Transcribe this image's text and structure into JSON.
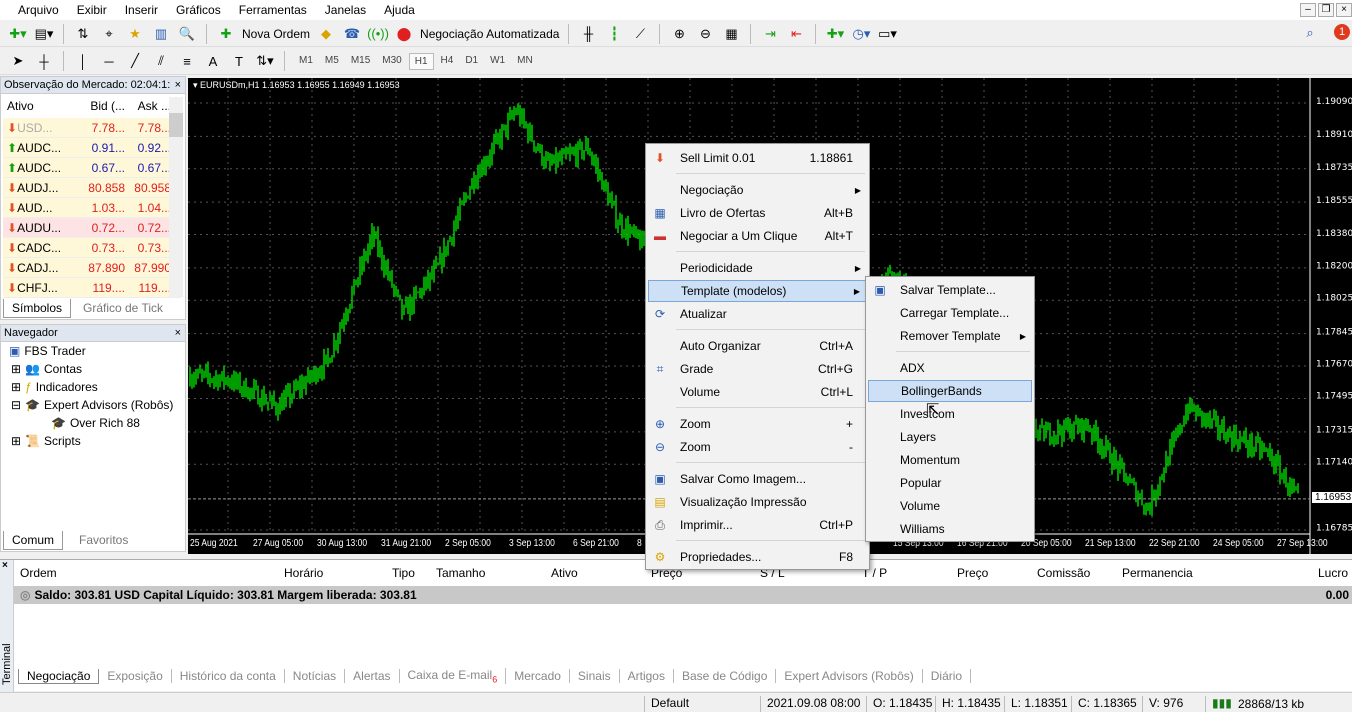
{
  "menu": [
    "Arquivo",
    "Exibir",
    "Inserir",
    "Gráficos",
    "Ferramentas",
    "Janelas",
    "Ajuda"
  ],
  "toolbar": {
    "new_order": "Nova Ordem",
    "auto_trading": "Negociação Automatizada",
    "notif_count": "1"
  },
  "timeframes": [
    "M1",
    "M5",
    "M15",
    "M30",
    "H1",
    "H4",
    "D1",
    "W1",
    "MN"
  ],
  "active_timeframe": "H1",
  "market_watch": {
    "title": "Observação do Mercado: 02:04:1:",
    "cols": [
      "Ativo",
      "Bid (...",
      "Ask ..."
    ],
    "rows": [
      {
        "sym": "USD...",
        "bid": "7.78...",
        "ask": "7.78...",
        "dir": "down",
        "color": "red",
        "dim": true
      },
      {
        "sym": "AUDC...",
        "bid": "0.91...",
        "ask": "0.92...",
        "dir": "up",
        "color": "blue"
      },
      {
        "sym": "AUDC...",
        "bid": "0.67...",
        "ask": "0.67...",
        "dir": "up",
        "color": "blue"
      },
      {
        "sym": "AUDJ...",
        "bid": "80.858",
        "ask": "80.958",
        "dir": "down",
        "color": "red"
      },
      {
        "sym": "AUD...",
        "bid": "1.03...",
        "ask": "1.04...",
        "dir": "down",
        "color": "red"
      },
      {
        "sym": "AUDU...",
        "bid": "0.72...",
        "ask": "0.72...",
        "dir": "down",
        "color": "red",
        "selected": true
      },
      {
        "sym": "CADC...",
        "bid": "0.73...",
        "ask": "0.73...",
        "dir": "down",
        "color": "red"
      },
      {
        "sym": "CADJ...",
        "bid": "87.890",
        "ask": "87.990",
        "dir": "down",
        "color": "red"
      },
      {
        "sym": "CHFJ...",
        "bid": "119....",
        "ask": "119....",
        "dir": "down",
        "color": "red"
      }
    ],
    "tabs": [
      "Símbolos",
      "Gráfico de Tick"
    ]
  },
  "navigator": {
    "title": "Navegador",
    "items": [
      "FBS Trader",
      "Contas",
      "Indicadores",
      "Expert Advisors (Robôs)",
      "Over Rich 88",
      "Scripts"
    ],
    "tabs": [
      "Comum",
      "Favoritos"
    ]
  },
  "chart": {
    "header": "EURUSDm,H1  1.16953 1.16955 1.16949 1.16953",
    "current_price": "1.16953",
    "price_labels": [
      "1.19090",
      "1.18910",
      "1.18735",
      "1.18555",
      "1.18380",
      "1.18200",
      "1.18025",
      "1.17845",
      "1.17670",
      "1.17495",
      "1.17315",
      "1.17140",
      "1.16785"
    ],
    "time_labels": [
      "25 Aug 2021",
      "27 Aug 05:00",
      "30 Aug 13:00",
      "31 Aug 21:00",
      "2 Sep 05:00",
      "3 Sep 13:00",
      "6 Sep 21:00",
      "8",
      "15 Sep 13:00",
      "16 Sep 21:00",
      "20 Sep 05:00",
      "21 Sep 13:00",
      "22 Sep 21:00",
      "24 Sep 05:00",
      "27 Sep 13:00"
    ],
    "bar_color": "#00e000"
  },
  "context_menu": [
    {
      "label": "Sell Limit 0.01",
      "shortcut": "1.18861",
      "icon": "sell-arrow-icon"
    },
    {
      "label": "Negociação",
      "submenu": true
    },
    {
      "label": "Livro de Ofertas",
      "shortcut": "Alt+B",
      "icon": "depth-of-market-icon"
    },
    {
      "label": "Negociar a Um Clique",
      "shortcut": "Alt+T",
      "icon": "one-click-icon"
    },
    {
      "label": "Periodicidade",
      "submenu": true
    },
    {
      "label": "Template (modelos)",
      "submenu": true,
      "highlighted": true
    },
    {
      "label": "Atualizar",
      "icon": "refresh-icon"
    },
    {
      "label": "Auto Organizar",
      "shortcut": "Ctrl+A"
    },
    {
      "label": "Grade",
      "shortcut": "Ctrl+G",
      "icon": "grid-icon"
    },
    {
      "label": "Volume",
      "shortcut": "Ctrl+L"
    },
    {
      "label": "Zoom",
      "shortcut": "+",
      "icon": "zoom-in-icon"
    },
    {
      "label": "Zoom",
      "shortcut": "-",
      "icon": "zoom-out-icon"
    },
    {
      "label": "Salvar Como Imagem...",
      "icon": "save-image-icon"
    },
    {
      "label": "Visualização Impressão",
      "icon": "print-preview-icon"
    },
    {
      "label": "Imprimir...",
      "shortcut": "Ctrl+P",
      "icon": "print-icon"
    },
    {
      "label": "Propriedades...",
      "shortcut": "F8",
      "icon": "properties-icon"
    }
  ],
  "template_submenu": [
    {
      "label": "Salvar Template...",
      "icon": "save-template-icon"
    },
    {
      "label": "Carregar Template..."
    },
    {
      "label": "Remover Template",
      "submenu": true
    },
    {
      "label": "ADX"
    },
    {
      "label": "BollingerBands",
      "highlighted": true
    },
    {
      "label": "Investcom"
    },
    {
      "label": "Layers"
    },
    {
      "label": "Momentum"
    },
    {
      "label": "Popular"
    },
    {
      "label": "Volume"
    },
    {
      "label": "Williams"
    }
  ],
  "terminal": {
    "label": "Terminal",
    "cols": [
      "Ordem",
      "Horário",
      "Tipo",
      "Tamanho",
      "Ativo",
      "Preço",
      "S / L",
      "T / P",
      "Preço",
      "Comissão",
      "Permanencia",
      "Lucro"
    ],
    "balance": "Saldo: 303.81 USD  Capital Líquido: 303.81  Margem liberada: 303.81",
    "profit": "0.00",
    "tabs": [
      "Negociação",
      "Exposição",
      "Histórico da conta",
      "Notícias",
      "Alertas",
      "Caixa de E-mail",
      "Mercado",
      "Sinais",
      "Artigos",
      "Base de Código",
      "Expert Advisors (Robôs)",
      "Diário"
    ],
    "mail_badge": "6"
  },
  "status": {
    "profile": "Default",
    "time": "2021.09.08 08:00",
    "open": "O: 1.18435",
    "high": "H: 1.18435",
    "low": "L: 1.18351",
    "close": "C: 1.18365",
    "volume": "V: 976",
    "traffic": "28868/13 kb"
  }
}
